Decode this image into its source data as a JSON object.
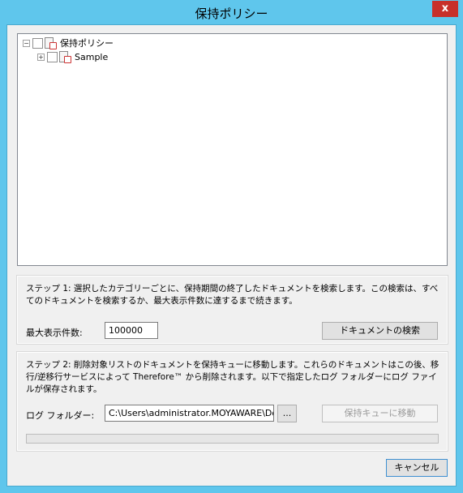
{
  "window": {
    "title": "保持ポリシー",
    "close_glyph": "x"
  },
  "tree": {
    "root": {
      "label": "保持ポリシー",
      "expander": "−"
    },
    "children": [
      {
        "label": "Sample",
        "expander": "+"
      }
    ]
  },
  "step1": {
    "text": "ステップ 1: 選択したカテゴリーごとに、保持期間の終了したドキュメントを検索します。この検索は、すべてのドキュメントを検索するか、最大表示件数に達するまで続きます。",
    "max_label": "最大表示件数:",
    "max_value": "100000",
    "search_button": "ドキュメントの検索"
  },
  "step2": {
    "text": "ステップ 2: 削除対象リストのドキュメントを保持キューに移動します。これらのドキュメントはこの後、移行/逆移行サービスによって Therefore™ から削除されます。以下で指定したログ フォルダーにログ ファイルが保存されます。",
    "folder_label": "ログ フォルダー:",
    "folder_value": "C:\\Users\\administrator.MOYAWARE\\Docu",
    "browse_button": "...",
    "move_button": "保持キューに移動",
    "progress": 0
  },
  "footer": {
    "cancel_button": "キャンセル"
  },
  "colors": {
    "titlebar": "#5fc6ec",
    "close": "#c7302a",
    "progress_fill": "#06b025"
  }
}
